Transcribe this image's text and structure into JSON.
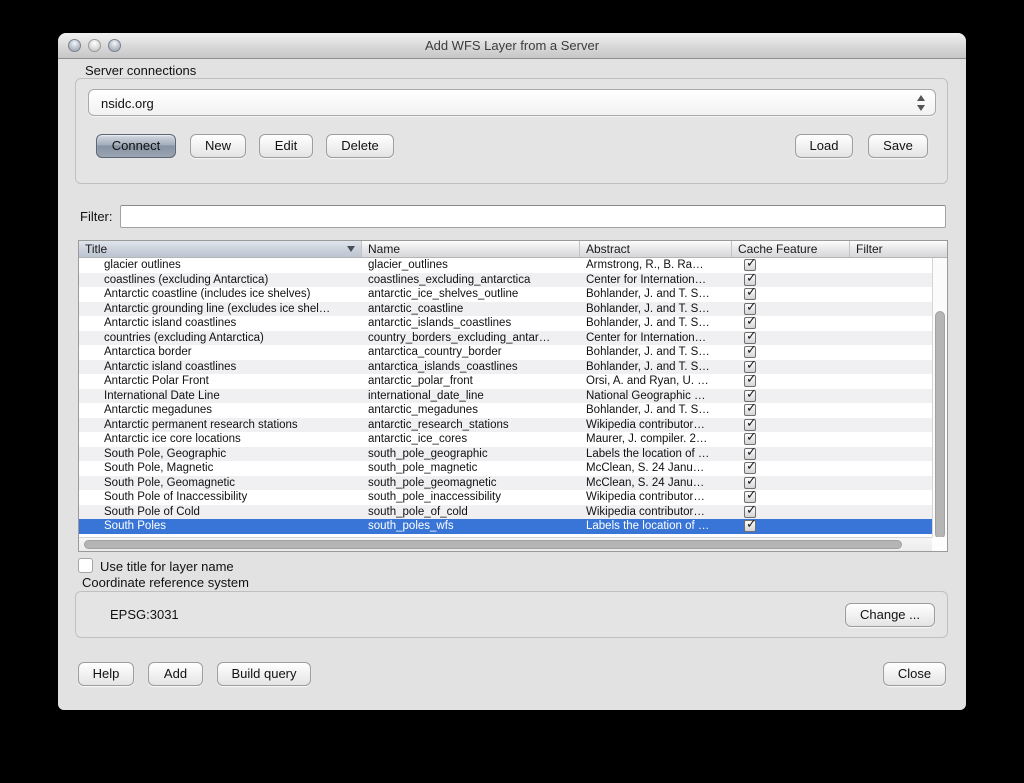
{
  "window": {
    "title": "Add WFS Layer from a Server"
  },
  "server_connections": {
    "group_label": "Server connections",
    "selected_connection": "nsidc.org",
    "buttons": {
      "connect": "Connect",
      "new": "New",
      "edit": "Edit",
      "delete": "Delete",
      "load": "Load",
      "save": "Save"
    }
  },
  "filter": {
    "label": "Filter:",
    "value": ""
  },
  "table": {
    "columns": {
      "title": "Title",
      "name": "Name",
      "abstract": "Abstract",
      "cache_feature": "Cache Feature",
      "filter": "Filter"
    },
    "sorted_column": "Title",
    "rows": [
      {
        "title": "glacier outlines",
        "name": "glacier_outlines",
        "abstract": "Armstrong, R., B. Ra…",
        "cache": true,
        "selected": false
      },
      {
        "title": "coastlines (excluding Antarctica)",
        "name": "coastlines_excluding_antarctica",
        "abstract": "Center for Internation…",
        "cache": true,
        "selected": false
      },
      {
        "title": "Antarctic coastline (includes ice shelves)",
        "name": "antarctic_ice_shelves_outline",
        "abstract": "Bohlander, J. and T. S…",
        "cache": true,
        "selected": false
      },
      {
        "title": "Antarctic grounding line (excludes ice shel…",
        "name": "antarctic_coastline",
        "abstract": "Bohlander, J. and T. S…",
        "cache": true,
        "selected": false
      },
      {
        "title": "Antarctic island coastlines",
        "name": "antarctic_islands_coastlines",
        "abstract": "Bohlander, J. and T. S…",
        "cache": true,
        "selected": false
      },
      {
        "title": "countries (excluding Antarctica)",
        "name": "country_borders_excluding_antar…",
        "abstract": "Center for Internation…",
        "cache": true,
        "selected": false
      },
      {
        "title": "Antarctica border",
        "name": "antarctica_country_border",
        "abstract": "Bohlander, J. and T. S…",
        "cache": true,
        "selected": false
      },
      {
        "title": "Antarctic island coastlines",
        "name": "antarctica_islands_coastlines",
        "abstract": "Bohlander, J. and T. S…",
        "cache": true,
        "selected": false
      },
      {
        "title": "Antarctic Polar Front",
        "name": "antarctic_polar_front",
        "abstract": "Orsi, A. and Ryan, U. …",
        "cache": true,
        "selected": false
      },
      {
        "title": "International Date Line",
        "name": "international_date_line",
        "abstract": "National Geographic …",
        "cache": true,
        "selected": false
      },
      {
        "title": "Antarctic megadunes",
        "name": "antarctic_megadunes",
        "abstract": "Bohlander, J. and T. S…",
        "cache": true,
        "selected": false
      },
      {
        "title": "Antarctic permanent research stations",
        "name": "antarctic_research_stations",
        "abstract": "Wikipedia contributor…",
        "cache": true,
        "selected": false
      },
      {
        "title": "Antarctic ice core locations",
        "name": "antarctic_ice_cores",
        "abstract": "Maurer, J. compiler. 2…",
        "cache": true,
        "selected": false
      },
      {
        "title": "South Pole, Geographic",
        "name": "south_pole_geographic",
        "abstract": "Labels the location of …",
        "cache": true,
        "selected": false
      },
      {
        "title": "South Pole, Magnetic",
        "name": "south_pole_magnetic",
        "abstract": "McClean, S. 24 Janu…",
        "cache": true,
        "selected": false
      },
      {
        "title": "South Pole, Geomagnetic",
        "name": "south_pole_geomagnetic",
        "abstract": "McClean, S. 24 Janu…",
        "cache": true,
        "selected": false
      },
      {
        "title": "South Pole of Inaccessibility",
        "name": "south_pole_inaccessibility",
        "abstract": "Wikipedia contributor…",
        "cache": true,
        "selected": false
      },
      {
        "title": "South Pole of Cold",
        "name": "south_pole_of_cold",
        "abstract": "Wikipedia contributor…",
        "cache": true,
        "selected": false
      },
      {
        "title": "South Poles",
        "name": "south_poles_wfs",
        "abstract": "Labels the location of …",
        "cache": true,
        "selected": true
      }
    ]
  },
  "options": {
    "use_title_label": "Use title for layer name",
    "use_title_checked": false
  },
  "crs": {
    "group_label": "Coordinate reference system",
    "value": "EPSG:3031",
    "change_button": "Change ..."
  },
  "footer_buttons": {
    "help": "Help",
    "add": "Add",
    "build_query": "Build query",
    "close": "Close"
  }
}
